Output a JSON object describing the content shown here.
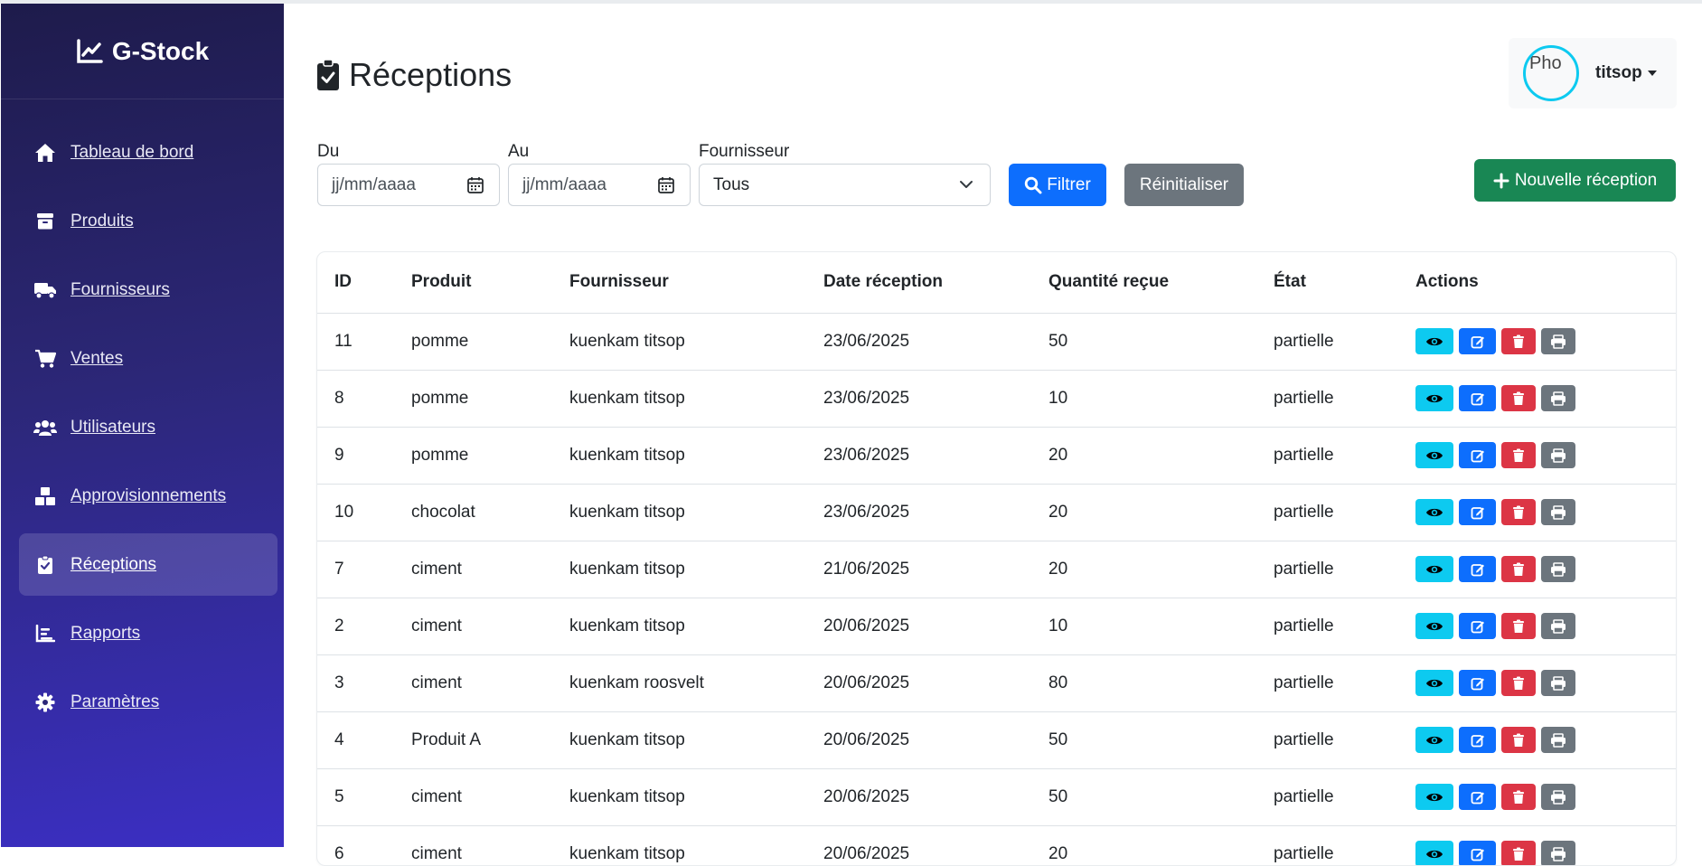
{
  "brand": {
    "name": "G-Stock",
    "icon": "chart-line-icon"
  },
  "sidebar": {
    "items": [
      {
        "label": "Tableau de bord",
        "icon": "home-icon",
        "active": false
      },
      {
        "label": "Produits",
        "icon": "box-icon",
        "active": false
      },
      {
        "label": "Fournisseurs",
        "icon": "truck-icon",
        "active": false
      },
      {
        "label": "Ventes",
        "icon": "cart-icon",
        "active": false
      },
      {
        "label": "Utilisateurs",
        "icon": "users-icon",
        "active": false
      },
      {
        "label": "Approvisionnements",
        "icon": "boxes-icon",
        "active": false
      },
      {
        "label": "Réceptions",
        "icon": "clipboard-check-icon",
        "active": true
      },
      {
        "label": "Rapports",
        "icon": "chart-bar-icon",
        "active": false
      },
      {
        "label": "Paramètres",
        "icon": "gear-icon",
        "active": false
      }
    ]
  },
  "header": {
    "title": "Réceptions",
    "user": {
      "avatar_alt": "Pho",
      "name": "titsop"
    }
  },
  "filters": {
    "from_label": "Du",
    "from_placeholder": "jj/mm/aaaa",
    "to_label": "Au",
    "to_placeholder": "jj/mm/aaaa",
    "supplier_label": "Fournisseur",
    "supplier_value": "Tous",
    "filter_button": "Filtrer",
    "reset_button": "Réinitialiser",
    "new_button": "Nouvelle réception"
  },
  "table": {
    "headers": [
      "ID",
      "Produit",
      "Fournisseur",
      "Date réception",
      "Quantité reçue",
      "État",
      "Actions"
    ],
    "rows": [
      [
        "11",
        "pomme",
        "kuenkam titsop",
        "23/06/2025",
        "50",
        "partielle"
      ],
      [
        "8",
        "pomme",
        "kuenkam titsop",
        "23/06/2025",
        "10",
        "partielle"
      ],
      [
        "9",
        "pomme",
        "kuenkam titsop",
        "23/06/2025",
        "20",
        "partielle"
      ],
      [
        "10",
        "chocolat",
        "kuenkam titsop",
        "23/06/2025",
        "20",
        "partielle"
      ],
      [
        "7",
        "ciment",
        "kuenkam titsop",
        "21/06/2025",
        "20",
        "partielle"
      ],
      [
        "2",
        "ciment",
        "kuenkam titsop",
        "20/06/2025",
        "10",
        "partielle"
      ],
      [
        "3",
        "ciment",
        "kuenkam roosvelt",
        "20/06/2025",
        "80",
        "partielle"
      ],
      [
        "4",
        "Produit A",
        "kuenkam titsop",
        "20/06/2025",
        "50",
        "partielle"
      ],
      [
        "5",
        "ciment",
        "kuenkam titsop",
        "20/06/2025",
        "50",
        "partielle"
      ],
      [
        "6",
        "ciment",
        "kuenkam titsop",
        "20/06/2025",
        "20",
        "partielle"
      ]
    ]
  },
  "colors": {
    "sidebar_top": "#1e1b4b",
    "sidebar_bottom": "#3b2fc4",
    "primary": "#0d6efd",
    "info": "#0dcaf0",
    "danger": "#dc3545",
    "secondary": "#6c757d",
    "success": "#198754"
  }
}
